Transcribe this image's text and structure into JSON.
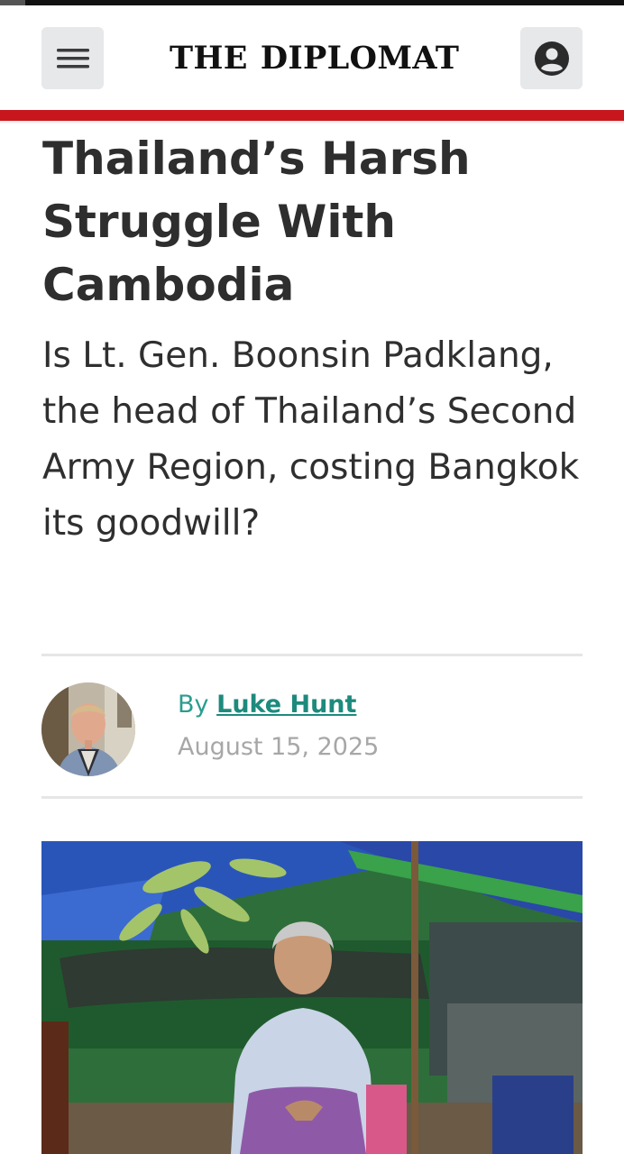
{
  "header": {
    "logo_left": "THE",
    "logo_right": "DIPLOMAT",
    "menu_icon": "hamburger-menu-icon",
    "account_icon": "user-account-icon"
  },
  "article": {
    "title": "Thailand’s Harsh Struggle With Cambodia",
    "subtitle": "Is Lt. Gen. Boonsin Padklang, the head of Thailand’s Second Army Region, costing Bangkok its goodwill?",
    "byline_prefix": "By",
    "author": "Luke Hunt",
    "date": "August 15, 2025"
  },
  "colors": {
    "brand_red": "#c8161d",
    "author_link": "#1d8a7d",
    "date_gray": "#a7a7a7"
  }
}
